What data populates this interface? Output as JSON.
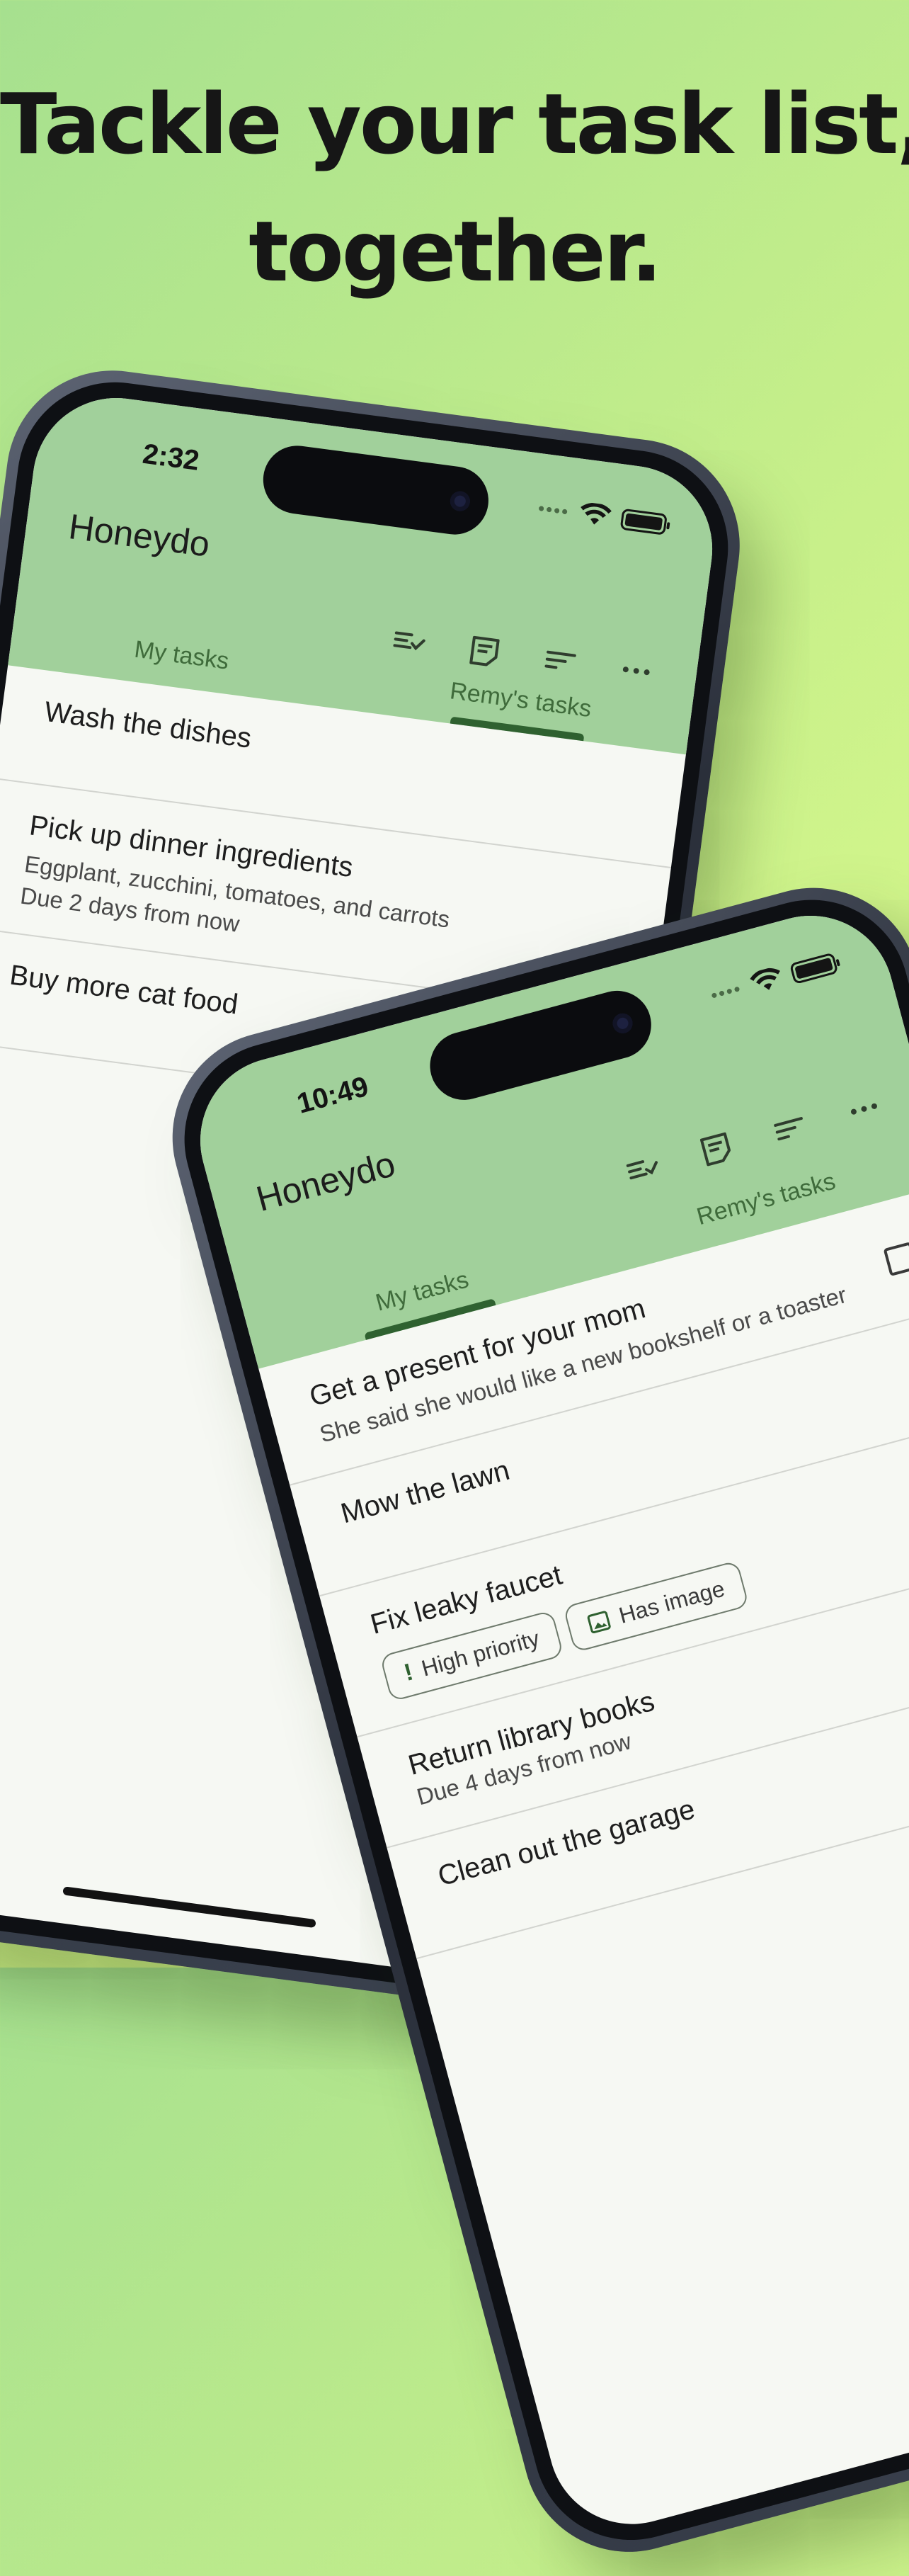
{
  "headline": {
    "line1": "Tackle your task list,",
    "line2": "together."
  },
  "app_name": "Honeydo",
  "tabs": {
    "mine": "My tasks",
    "partner": "Remy's tasks"
  },
  "colors": {
    "appbar": "#a1d09b",
    "accent": "#2f6130",
    "background": "#f6f8f3"
  },
  "toolbar_icons": [
    "completed-tasks-icon",
    "notes-icon",
    "sort-icon",
    "more-icon"
  ],
  "back_phone": {
    "time": "2:32",
    "active_tab": "partner",
    "tasks": [
      {
        "title": "Wash the dishes"
      },
      {
        "title": "Pick up dinner ingredients",
        "notes": "Eggplant, zucchini, tomatoes, and carrots",
        "due": "Due 2 days from now"
      },
      {
        "title": "Buy more cat food"
      }
    ]
  },
  "front_phone": {
    "time": "10:49",
    "active_tab": "mine",
    "tasks": [
      {
        "title": "Get a present for your mom",
        "notes": "She said she would like a new bookshelf or a toaster"
      },
      {
        "title": "Mow the lawn"
      },
      {
        "title": "Fix leaky faucet",
        "chips": [
          {
            "icon": "exclamation-icon",
            "label": "High priority"
          },
          {
            "icon": "image-icon",
            "label": "Has image"
          }
        ]
      },
      {
        "title": "Return library books",
        "due": "Due 4 days from now"
      },
      {
        "title": "Clean out the garage"
      }
    ]
  }
}
